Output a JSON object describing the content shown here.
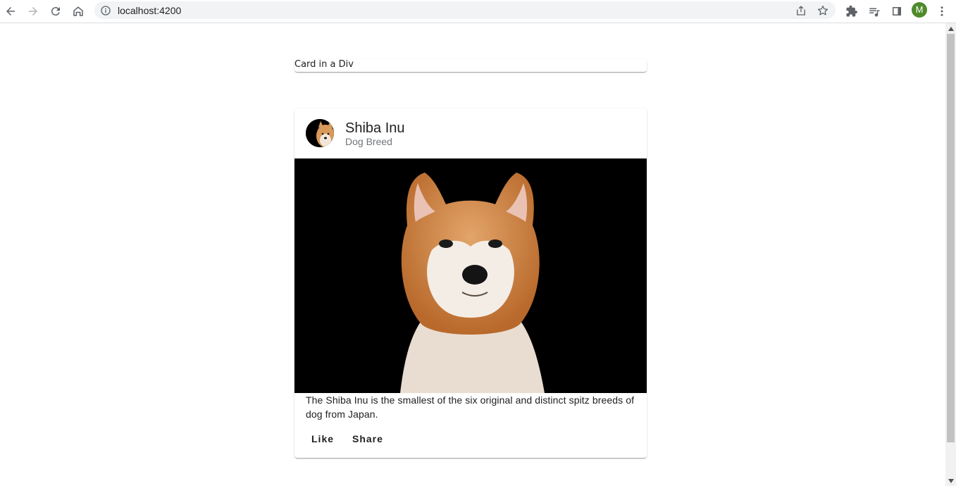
{
  "browser": {
    "url": "localhost:4200",
    "profile_initial": "M",
    "profile_color": "#4f8a2b",
    "icons": [
      "back-icon",
      "forward-icon",
      "reload-icon",
      "home-icon",
      "info-icon",
      "share-icon",
      "star-icon",
      "extensions-icon",
      "reading-list-icon",
      "side-panel-icon",
      "menu-icon"
    ]
  },
  "simple_card": {
    "text": "Card in a Div"
  },
  "card": {
    "title": "Shiba Inu",
    "subtitle": "Dog Breed",
    "description": "The Shiba Inu is the smallest of the six original and distinct spitz breeds of dog from Japan.",
    "actions": {
      "like": "Like",
      "share": "Share"
    }
  }
}
